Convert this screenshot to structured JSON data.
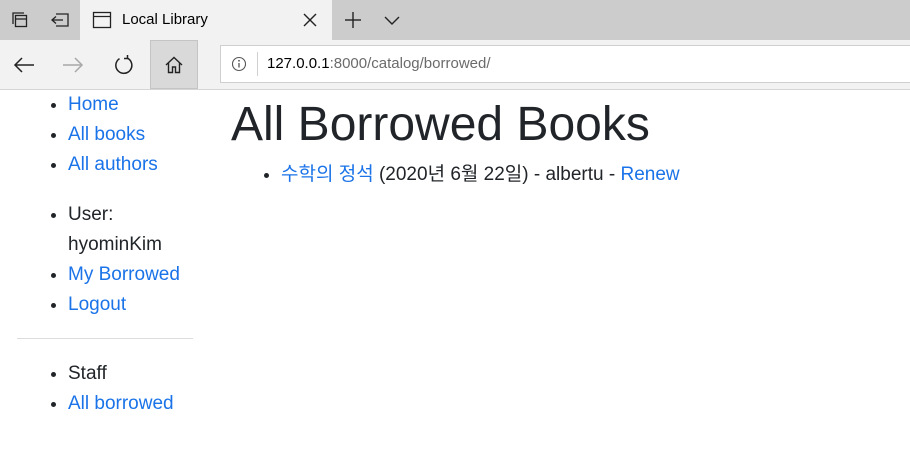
{
  "browser": {
    "tab_title": "Local Library",
    "url_host": "127.0.0.1",
    "url_port_path": ":8000/catalog/borrowed/"
  },
  "sidebar": {
    "links": [
      {
        "label": "Home"
      },
      {
        "label": "All books"
      },
      {
        "label": "All authors"
      }
    ],
    "user_label": "User:",
    "username": "hyominKim",
    "user_links": [
      {
        "label": "My Borrowed"
      },
      {
        "label": "Logout"
      }
    ],
    "staff_label": "Staff",
    "staff_links": [
      {
        "label": "All borrowed"
      }
    ]
  },
  "main": {
    "title": "All Borrowed Books",
    "items": [
      {
        "book_title": "수학의 정석",
        "due_text": "(2020년 6월 22일) - albertu - ",
        "renew_label": "Renew"
      }
    ]
  },
  "colors": {
    "link": "#1a73e8",
    "text": "#212529",
    "tabbar": "#cccccc",
    "toolbar": "#f2f2f2"
  },
  "icons": [
    "tab-list-icon",
    "set-aside-icon",
    "page-icon",
    "close-icon",
    "new-tab-icon",
    "chevron-down-icon",
    "back-icon",
    "forward-icon",
    "refresh-icon",
    "home-icon",
    "info-icon"
  ]
}
